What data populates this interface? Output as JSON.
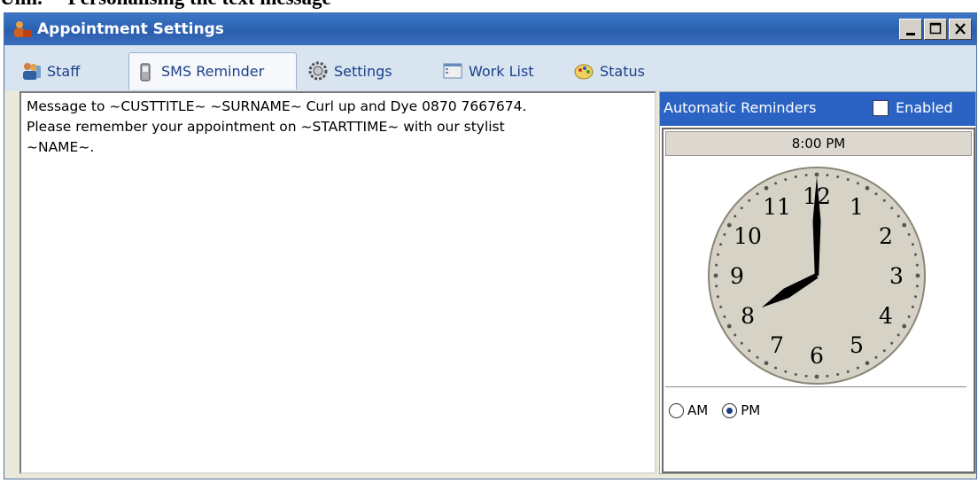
{
  "doc_heading": "Personalising the text message",
  "window": {
    "title": "Appointment Settings",
    "controls": {
      "minimize": "minimize-icon",
      "maximize": "maximize-icon",
      "close": "close-icon"
    }
  },
  "tabs": [
    {
      "label": "Staff",
      "icon": "staff-icon",
      "active": false
    },
    {
      "label": "SMS Reminder",
      "icon": "mobile-phone-icon",
      "active": true
    },
    {
      "label": "Settings",
      "icon": "gear-icon",
      "active": false
    },
    {
      "label": "Work List",
      "icon": "list-icon",
      "active": false
    },
    {
      "label": "Status",
      "icon": "palette-icon",
      "active": false
    }
  ],
  "message": {
    "line1": "Message to ~CUSTTITLE~ ~SURNAME~ Curl up and Dye 0870 7667674.",
    "line2": "Please remember your appointment on ~STARTTIME~ with our stylist",
    "line3": "~NAME~."
  },
  "reminders": {
    "header_label": "Automatic Reminders",
    "enabled_label": "Enabled",
    "enabled": false,
    "time_display": "8:00 PM",
    "clock": {
      "hour": 8,
      "minute": 0,
      "numbers": [
        "12",
        "1",
        "2",
        "3",
        "4",
        "5",
        "6",
        "7",
        "8",
        "9",
        "10",
        "11"
      ]
    },
    "am_label": "AM",
    "pm_label": "PM",
    "selected": "PM"
  },
  "colors": {
    "title_bar": "#2a5fae",
    "auto_bar": "#2a63c4",
    "tab_text": "#1a3f8a",
    "clock_face": "#d8d4c8"
  }
}
